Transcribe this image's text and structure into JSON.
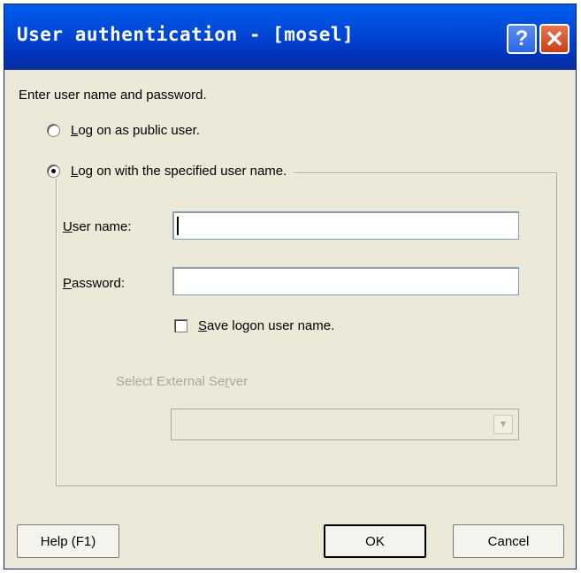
{
  "window": {
    "title": "User authentication - [mosel]",
    "help_glyph": "?",
    "close_glyph": "✕"
  },
  "prompt": "Enter user name and password.",
  "options": {
    "public_user": {
      "mnemonic": "L",
      "rest": "og on as public user.",
      "checked": false
    },
    "specified_user": {
      "mnemonic": "L",
      "rest": "og on with the specified user name.",
      "checked": true
    }
  },
  "fields": {
    "user_name": {
      "mnemonic": "U",
      "rest": "ser name:",
      "value": ""
    },
    "password": {
      "mnemonic": "P",
      "rest": "assword:",
      "value": ""
    }
  },
  "save_logon": {
    "mnemonic": "S",
    "rest": "ave logon user name.",
    "checked": false
  },
  "external_server": {
    "label_before": "Select External Se",
    "mnemonic": "r",
    "label_after": "ver",
    "selected": ""
  },
  "buttons": {
    "help": "Help (F1)",
    "ok": "OK",
    "cancel": "Cancel"
  }
}
